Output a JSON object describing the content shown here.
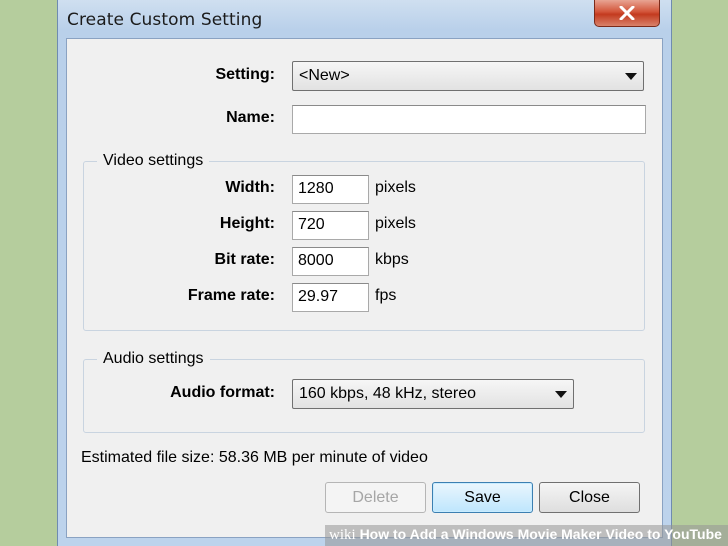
{
  "window": {
    "title": "Create Custom Setting"
  },
  "form": {
    "setting_label": "Setting:",
    "setting_value": "<New>",
    "name_label": "Name:",
    "name_value": ""
  },
  "video": {
    "group_title": "Video settings",
    "width_label": "Width:",
    "width_value": "1280",
    "width_unit": "pixels",
    "height_label": "Height:",
    "height_value": "720",
    "height_unit": "pixels",
    "bitrate_label": "Bit rate:",
    "bitrate_value": "8000",
    "bitrate_unit": "kbps",
    "framerate_label": "Frame rate:",
    "framerate_value": "29.97",
    "framerate_unit": "fps"
  },
  "audio": {
    "group_title": "Audio settings",
    "format_label": "Audio format:",
    "format_value": "160 kbps, 48 kHz, stereo"
  },
  "estimate": "Estimated file size: 58.36 MB per minute of video",
  "buttons": {
    "delete": "Delete",
    "save": "Save",
    "close": "Close"
  },
  "watermark": {
    "brand": "wiki",
    "text": "How to Add a Windows Movie Maker Video to YouTube"
  },
  "colors": {
    "background": "#b5cd9d",
    "close_button": "#c9452a",
    "client": "#f0f0f0"
  }
}
